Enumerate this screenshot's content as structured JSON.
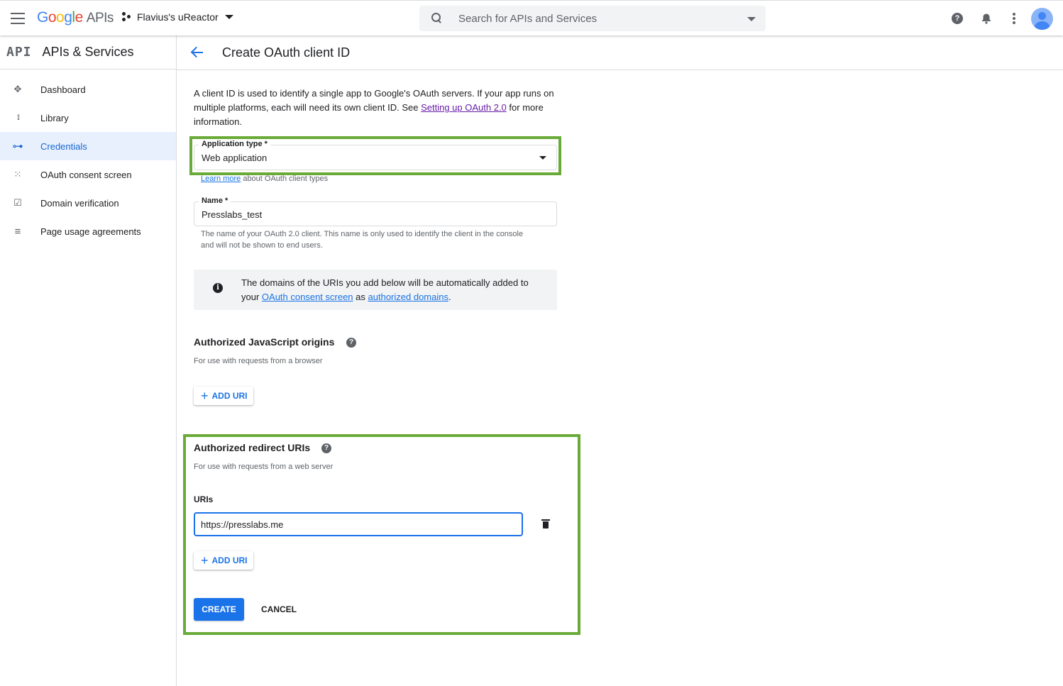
{
  "topbar": {
    "logo_google": [
      "G",
      "o",
      "o",
      "g",
      "l",
      "e"
    ],
    "logo_apis": "APIs",
    "project_name": "Flavius's uReactor",
    "search_placeholder": "Search for APIs and Services",
    "icons": [
      "menu-icon",
      "search-icon",
      "help-icon",
      "bell-icon",
      "more-vert-icon",
      "avatar"
    ]
  },
  "sidebar": {
    "logo": "API",
    "title": "APIs & Services",
    "items": [
      {
        "label": "Dashboard",
        "icon": "dashboard-icon",
        "glyph": "✥"
      },
      {
        "label": "Library",
        "icon": "library-icon",
        "glyph": "⁞⁞⁞"
      },
      {
        "label": "Credentials",
        "icon": "key-icon",
        "glyph": "⊶",
        "active": true
      },
      {
        "label": "OAuth consent screen",
        "icon": "consent-icon",
        "glyph": "⁙"
      },
      {
        "label": "Domain verification",
        "icon": "checkbox-icon",
        "glyph": "☑"
      },
      {
        "label": "Page usage agreements",
        "icon": "settings-list-icon",
        "glyph": "≡"
      }
    ]
  },
  "page": {
    "title": "Create OAuth client ID",
    "intro_part1": "A client ID is used to identify a single app to Google's OAuth servers. If your app runs on multiple platforms, each will need its own client ID. See ",
    "intro_link": "Setting up OAuth 2.0",
    "intro_part2": " for more information."
  },
  "form": {
    "app_type_label": "Application type *",
    "app_type_value": "Web application",
    "learn_more_link": "Learn more",
    "learn_more_text": " about OAuth client types",
    "name_label": "Name *",
    "name_value": "Presslabs_test",
    "name_hint": "The name of your OAuth 2.0 client. This name is only used to identify the client in the console and will not be shown to end users."
  },
  "info": {
    "part1": "The domains of the URIs you add below will be automatically added to your ",
    "link1": "OAuth consent screen",
    "part2": " as ",
    "link2": "authorized domains",
    "part3": "."
  },
  "js_origins": {
    "title": "Authorized JavaScript origins",
    "subtitle": "For use with requests from a browser",
    "add_label": "ADD URI"
  },
  "redirect_uris": {
    "title": "Authorized redirect URIs",
    "subtitle": "For use with requests from a web server",
    "uris_label": "URIs",
    "uri_value": "https://presslabs.me",
    "add_label": "ADD URI"
  },
  "actions": {
    "create_label": "CREATE",
    "cancel_label": "CANCEL"
  },
  "colors": {
    "accent": "#1a73e8",
    "highlight_box": "#6aaa38",
    "visited_link": "#681da8"
  }
}
